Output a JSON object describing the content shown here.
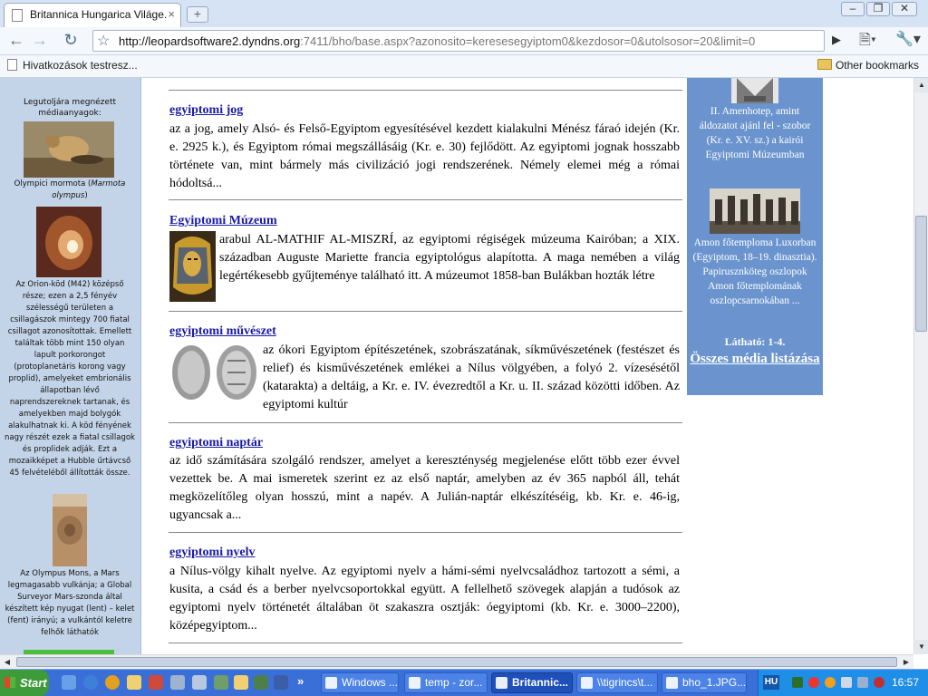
{
  "browser": {
    "tab_title": "Britannica Hungarica Világe...",
    "tab_close": "×",
    "new_tab": "+",
    "window_controls": {
      "minimize": "–",
      "maximize": "❐",
      "close": "✕"
    },
    "url_host": "http://leopardsoftware2.dyndns.org",
    "url_rest": ":7411/bho/base.aspx?azonosito=keresesegyiptom0&kezdosor=0&utolsosor=20&limit=0",
    "bookmarks_left": "Hivatkozások testresz...",
    "bookmarks_right": "Other bookmarks"
  },
  "left_panel": {
    "heading": "Legutoljára megnézett médiaanyagok:",
    "items": [
      {
        "caption_a": "Olympici mormota (",
        "caption_i": "Marmota olympus",
        "caption_b": ")"
      },
      {
        "caption": "Az Orion-köd (M42) középső része; ezen a 2,5 fényév szélességű területen a csillagászok mintegy 700 fiatal csillagot azonosítottak. Emellett találtak több mint 150 olyan lapult porkorongot (protoplanetáris korong vagy proplid), amelyeket embrionális állapotban lévő naprendszereknek tartanak, és amelyekben majd bolygók alakulhatnak ki. A köd fényének nagy részét ezek a fiatal csillagok és proplidek adják. Ezt a mozaikképet a Hubble űrtávcső 45 felvételéből állították össze."
      },
      {
        "caption": "Az Olympus Mons, a Mars legmagasabb vulkánja; a Global Surveyor Mars-szonda által készített kép nyugat (lent) – kelet (fent) irányú; a vulkántól keletre felhők láthatók"
      }
    ]
  },
  "results": [
    {
      "title": "egyiptomi jog",
      "text": "az a jog, amely Alsó- és Felső-Egyiptom egyesítésével kezdett kialakulni Ménész fáraó idején (Kr. e. 2925 k.), és Egyiptom római megszállásáig (Kr. e. 30) fejlődött. Az egyiptomi jognak hosszabb története van, mint bármely más civilizáció jogi rendszerének. Némely elemei még a római hódoltsá..."
    },
    {
      "title": "Egyiptomi Múzeum",
      "text": "arabul AL-MATHIF AL-MISZRÍ, az egyiptomi régiségek múzeuma Kairóban; a XIX. században Auguste Mariette francia egyiptológus alapította. A maga nemében a világ legértékesebb gyűjteménye található itt. A múzeumot 1858-ban Bulákban hozták létre"
    },
    {
      "title": "egyiptomi művészet",
      "text": "az ókori Egyiptom építészetének, szobrászatának, síkművészetének (festészet és relief) és kisművészetének emlékei a Nílus völgyében, a folyó 2. vízesésétől (katarakta) a deltáig, a Kr. e. IV. évezredtől a Kr. u. II. század közötti időben. Az egyiptomi kultúr"
    },
    {
      "title": "egyiptomi naptár",
      "text": "az idő számítására szolgáló rendszer, amelyet a kereszténység megjelenése előtt több ezer évvel vezettek be. A mai ismeretek szerint ez az első naptár, amelyben az év 365 napból áll, tehát megközelítőleg olyan hosszú, mint a napév. A Julián-naptár elkészítéséig, kb. Kr. e. 46-ig, ugyancsak a..."
    },
    {
      "title": "egyiptomi nyelv",
      "text": "a Nílus-völgy kihalt nyelve. Az egyiptomi nyelv a hámi-sémi nyelvcsaládhoz tartozott a sémi, a kusita, a csád és a berber nyelvcsoportokkal együtt. A fellelhető szövegek alapján a tudósok az egyiptomi nyelv történetét általában öt szakaszra osztják: óegyiptomi (kb. Kr. e. 3000–2200), középegyiptom..."
    }
  ],
  "right_panel": {
    "caption1": "II. Amenhotep, amint áldozatot ajánl fel - szobor (Kr. e. XV. sz.) a kairói Egyiptomi Múzeumban",
    "caption2": "Amon főtemploma Luxorban (Egyiptom, 18–19. dinasztia). Papirusznköteg oszlopok Amon főtemplomának oszlopcsarnokában ...",
    "count": "Látható: 1-4.",
    "link": "Összes média listázása"
  },
  "taskbar": {
    "start": "Start",
    "overflow": "»",
    "tasks": [
      "Windows ...",
      "temp - zor...",
      "Britannic...",
      "\\\\tigrincs\\t...",
      "bho_1.JPG..."
    ],
    "lang": "HU",
    "clock": "16:57"
  }
}
